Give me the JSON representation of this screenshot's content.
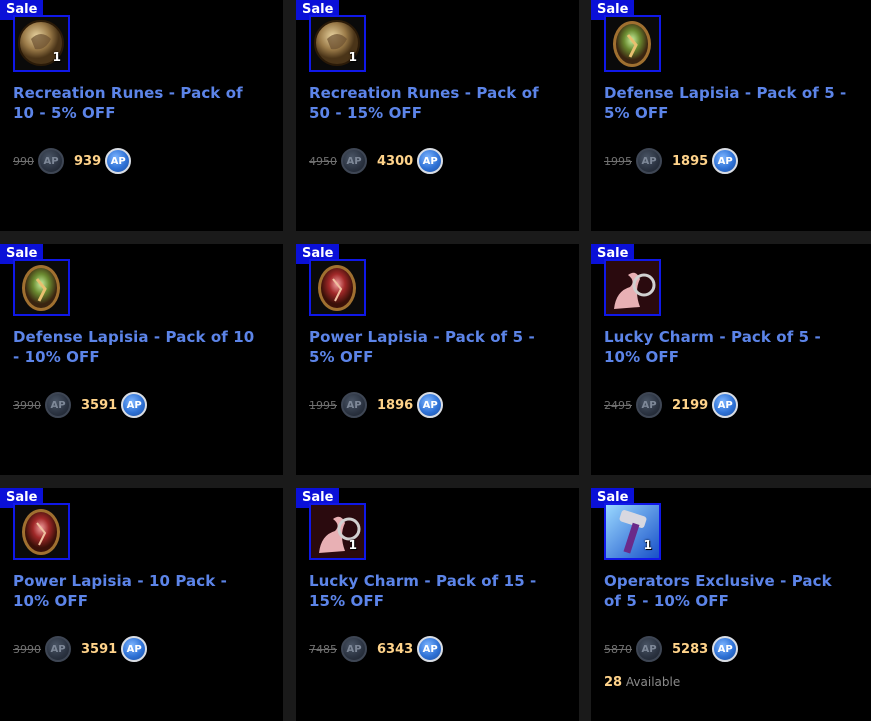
{
  "currency_icon": "ap-coin-icon",
  "sale_label": "Sale",
  "items": [
    {
      "title": "Recreation Runes - Pack of 10 - 5% OFF",
      "old_price": "990",
      "new_price": "939",
      "qty": "1",
      "icon": "rune-coin-icon"
    },
    {
      "title": "Recreation Runes - Pack of 50 - 15% OFF",
      "old_price": "4950",
      "new_price": "4300",
      "qty": "1",
      "icon": "rune-coin-icon"
    },
    {
      "title": "Defense Lapisia - Pack of 5 - 5% OFF",
      "old_price": "1995",
      "new_price": "1895",
      "qty": "",
      "icon": "defense-lapisia-icon"
    },
    {
      "title": "Defense Lapisia - Pack of 10 - 10% OFF",
      "old_price": "3990",
      "new_price": "3591",
      "qty": "",
      "icon": "defense-lapisia-icon"
    },
    {
      "title": "Power Lapisia - Pack of 5 - 5% OFF",
      "old_price": "1995",
      "new_price": "1896",
      "qty": "",
      "icon": "power-lapisia-icon"
    },
    {
      "title": "Lucky Charm - Pack of 5 - 10% OFF",
      "old_price": "2495",
      "new_price": "2199",
      "qty": "",
      "icon": "lucky-charm-icon"
    },
    {
      "title": "Power Lapisia - 10 Pack - 10% OFF",
      "old_price": "3990",
      "new_price": "3591",
      "qty": "",
      "icon": "power-lapisia-icon"
    },
    {
      "title": "Lucky Charm - Pack of 15 - 15% OFF",
      "old_price": "7485",
      "new_price": "6343",
      "qty": "1",
      "icon": "lucky-charm-icon"
    },
    {
      "title": "Operators Exclusive - Pack of 5 - 10% OFF",
      "old_price": "5870",
      "new_price": "5283",
      "qty": "1",
      "icon": "hammer-icon"
    }
  ],
  "availability": {
    "count": "28",
    "label": "Available"
  },
  "ap_label": "AP"
}
